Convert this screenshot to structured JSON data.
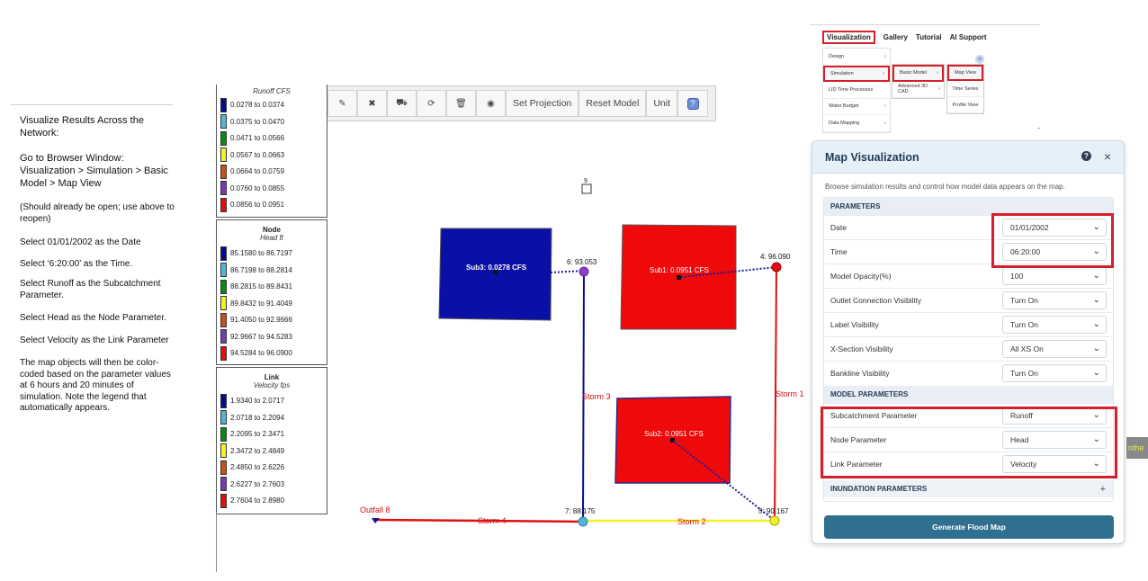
{
  "instructions": {
    "title": "Visualize Results Across the Network:",
    "go_to": "Go to Browser Window: Visualization > Simulation > Basic Model > Map View",
    "note": "(Should already be open; use above to reopen)",
    "step_date": "Select 01/01/2002 as the Date",
    "step_time": "Select ‘6:20:00’ as the Time.",
    "step_runoff": "Select Runoff as the Subcatchment Parameter.",
    "step_head": "Select Head as the Node Parameter.",
    "step_velocity": "Select Velocity as the Link Parameter",
    "summary": "The map objects will then be color-coded based on the parameter values at 6 hours and 20 minutes of simulation. Note the legend that automatically appears."
  },
  "legend": {
    "colors": [
      "#0a0a8c",
      "#56b4d3",
      "#0a8a14",
      "#f5f02a",
      "#c2541a",
      "#7a3aad",
      "#e01010"
    ],
    "runoff": {
      "subtitle": "Runoff CFS",
      "ranges": [
        "0.0278 to 0.0374",
        "0.0375 to 0.0470",
        "0.0471 to 0.0566",
        "0.0567 to 0.0663",
        "0.0664 to 0.0759",
        "0.0760 to 0.0855",
        "0.0856 to 0.0951"
      ]
    },
    "node": {
      "title": "Node",
      "subtitle": "Head ft",
      "ranges": [
        "85.1580 to 86.7197",
        "86.7198 to 88.2814",
        "88.2815 to 89.8431",
        "89.8432 to 91.4049",
        "91.4050 to 92.9666",
        "92.9667 to 94.5283",
        "94.5284 to 96.0900"
      ]
    },
    "link": {
      "title": "Link",
      "subtitle": "Velocity fps",
      "ranges": [
        "1.9340 to 2.0717",
        "2.0718 to 2.2094",
        "2.2095 to 2.3471",
        "2.3472 to 2.4849",
        "2.4850 to 2.6226",
        "2.6227 to 2.7603",
        "2.7604 to 2.8980"
      ]
    }
  },
  "toolbar": {
    "icons": [
      "edit-icon",
      "delete-icon",
      "truck-icon",
      "refresh-icon",
      "trash-icon",
      "target-icon"
    ],
    "set_projection": "Set Projection",
    "reset_model": "Reset Model",
    "unit": "Unit",
    "help": "?"
  },
  "map": {
    "rain_gage_label": "9",
    "sub3": "Sub3:  0.0278 CFS",
    "sub1": "Sub1:   0.0951 CFS",
    "sub2": "Sub2:  0.0951 CFS",
    "node6": "6:   93.053",
    "node4": "4:   96.090",
    "node7": "7:   88.175",
    "node5": "5:   90.167",
    "outfall": "Outfall 8",
    "storm1": "Storm 1",
    "storm2": "Storm 2",
    "storm3": "Storm 3",
    "storm4": "Storm 4",
    "colors": {
      "sub3": "#0a0fa6",
      "sub1": "#ee0a0a",
      "sub2": "#ee0a0a",
      "node6": "#8a3ec0",
      "node4": "#e01010",
      "node7": "#56b4d3",
      "node5": "#f5f02a",
      "storm1": "#e01010",
      "storm2": "#f5f02a",
      "storm3": "#0a0a8c",
      "storm4": "#e01010"
    }
  },
  "menu_shot": {
    "nav": [
      "Visualization",
      "Gallery",
      "Tutorial",
      "AI Support"
    ],
    "level1": [
      "Design",
      "Simulation",
      "LID Time Processes",
      "Water Budget",
      "Data Mapping"
    ],
    "level2": [
      "Basic Model",
      "Advanced 3D CAD"
    ],
    "level3": [
      "Map View",
      "Time Series",
      "Profile View"
    ]
  },
  "panel": {
    "title": "Map Visualization",
    "help": "?",
    "close": "×",
    "description": "Browse simulation results and control how model data appears on the map.",
    "parameters_header": "PARAMETERS",
    "rows": [
      {
        "label": "Date",
        "value": "01/01/2002"
      },
      {
        "label": "Time",
        "value": "06:20:00"
      },
      {
        "label": "Model Opacity(%)",
        "value": "100"
      },
      {
        "label": "Outlet Connection Visibility",
        "value": "Turn On"
      },
      {
        "label": "Label Visibility",
        "value": "Turn On"
      },
      {
        "label": "X-Section Visibility",
        "value": "All XS On"
      },
      {
        "label": "Bankline Visibility",
        "value": "Turn On"
      }
    ],
    "model_parameters_header": "MODEL PARAMETERS",
    "model_rows": [
      {
        "label": "Subcatchment Parameter",
        "value": "Runoff"
      },
      {
        "label": "Node Parameter",
        "value": "Head"
      },
      {
        "label": "Link Parameter",
        "value": "Velocity"
      }
    ],
    "inundation_header": "INUNDATION PARAMETERS",
    "plus": "+",
    "generate_button": "Generate Flood Map"
  },
  "side_tab": "nthe"
}
